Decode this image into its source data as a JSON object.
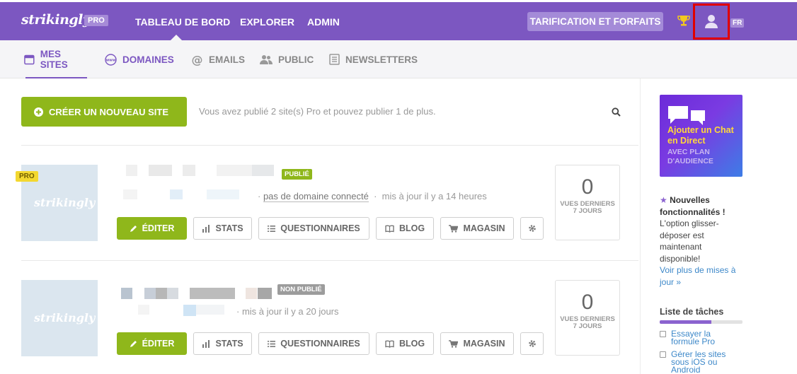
{
  "topnav": {
    "logo": "strikingly",
    "plan_badge": "PRO",
    "links": [
      "TABLEAU DE BORD",
      "EXPLORER",
      "ADMIN"
    ],
    "pricing_label": "TARIFICATION ET FORFAITS",
    "lang": "FR",
    "bg_color": "#7c57c1"
  },
  "subnav": {
    "items": [
      {
        "label": "MES SITES",
        "icon": "browser-icon",
        "active": true
      },
      {
        "label": "DOMAINES",
        "icon": "www-icon"
      },
      {
        "label": "EMAILS",
        "icon": "at-icon"
      },
      {
        "label": "PUBLIC",
        "icon": "people-icon"
      },
      {
        "label": "NEWSLETTERS",
        "icon": "newsletter-icon"
      }
    ]
  },
  "main": {
    "create_label": "CRÉER UN NOUVEAU SITE",
    "publish_info": "Vous avez publié 2 site(s) Pro et pouvez publier 1 de plus.",
    "sites": [
      {
        "thumb_logo": "strikingly",
        "pro_badge": "PRO",
        "status": "PUBLIÉ",
        "domain_text": "pas de domaine connecté",
        "updated": "mis à jour il y a 14 heures",
        "views": "0",
        "views_label": "VUES DERNIERS 7 JOURS"
      },
      {
        "thumb_logo": "strikingly",
        "status": "NON PUBLIÉ",
        "updated": "mis à jour il y a 20 jours",
        "views": "0",
        "views_label": "VUES DERNIERS 7 JOURS"
      }
    ],
    "buttons": {
      "edit": "ÉDITER",
      "stats": "STATS",
      "forms": "QUESTIONNAIRES",
      "blog": "BLOG",
      "store": "MAGASIN"
    }
  },
  "sidebar": {
    "promo_title": "Ajouter un Chat en Direct",
    "promo_sub": "AVEC PLAN D'AUDIENCE",
    "news_title": "Nouvelles fonctionnalités !",
    "news_body": "L'option glisser-déposer est maintenant disponible!",
    "news_link": "Voir plus de mises à jour »",
    "tasks_title": "Liste de tâches",
    "tasks_progress": 0.62,
    "tasks": [
      "Essayer la formule Pro",
      "Gérer les sites sous iOS ou Android"
    ]
  }
}
